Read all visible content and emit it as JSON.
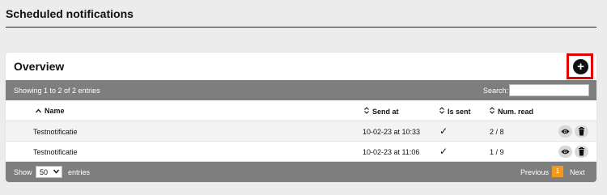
{
  "page": {
    "title": "Scheduled notifications"
  },
  "card": {
    "title": "Overview",
    "add_button_label": "+"
  },
  "toolbar": {
    "showing": "Showing 1 to 2 of 2 entries",
    "search_label": "Search:",
    "search_value": ""
  },
  "table": {
    "headers": {
      "name": "Name",
      "send_at": "Send at",
      "is_sent": "Is sent",
      "num_read": "Num. read"
    },
    "sort_icons": {
      "name": "up-arrow-icon",
      "others": "sort-both-icon"
    },
    "rows": [
      {
        "name": "Testnotificatie",
        "send_at": "10-02-23 at 10:33",
        "is_sent": "✓",
        "num_read": "2 / 8"
      },
      {
        "name": "Testnotificatie",
        "send_at": "10-02-23 at 11:06",
        "is_sent": "✓",
        "num_read": "1 / 9"
      }
    ],
    "row_actions": [
      "eye-icon",
      "trash-icon"
    ]
  },
  "footer": {
    "show_label": "Show",
    "page_size": "50",
    "entries_label": "entries",
    "previous": "Previous",
    "current_page": "1",
    "next": "Next"
  },
  "colors": {
    "toolbar_bg": "#7e7e7e",
    "highlight_border": "#e00000",
    "active_page": "#f29a1e"
  }
}
